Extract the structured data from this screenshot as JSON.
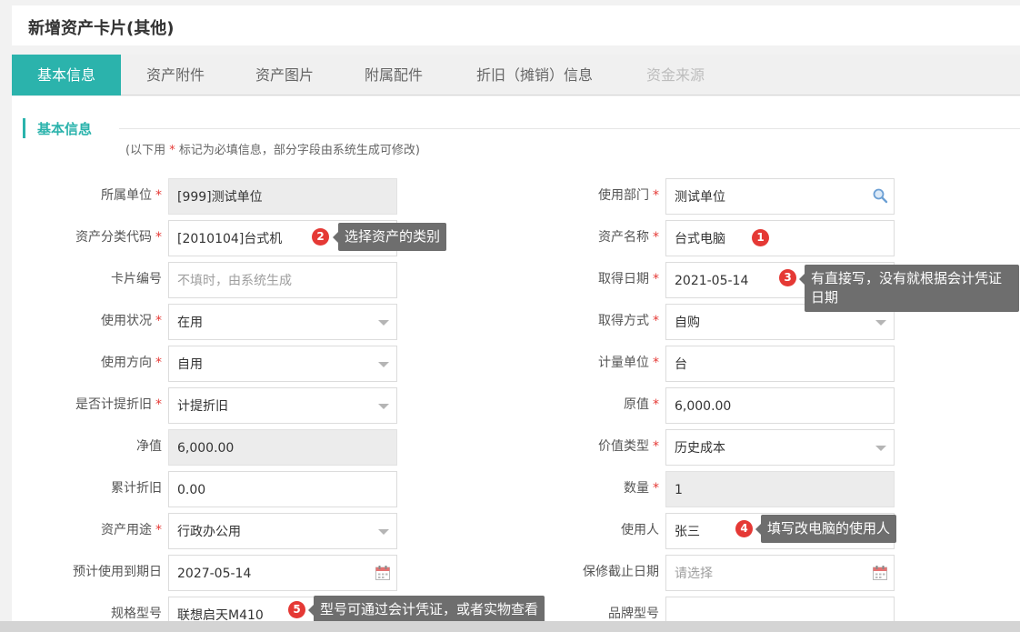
{
  "page": {
    "title": "新增资产卡片(其他)"
  },
  "tabs": [
    {
      "label": "基本信息",
      "active": true
    },
    {
      "label": "资产附件"
    },
    {
      "label": "资产图片"
    },
    {
      "label": "附属配件"
    },
    {
      "label": "折旧（摊销）信息"
    },
    {
      "label": "资金来源",
      "disabled": true
    }
  ],
  "section": {
    "title": "基本信息",
    "note_prefix": "(以下用",
    "note_star": "*",
    "note_suffix": " 标记为必填信息，部分字段由系统生成可修改)"
  },
  "form": {
    "left": [
      {
        "label": "所属单位",
        "required": true,
        "value": "[999]测试单位",
        "readonly": true
      },
      {
        "label": "资产分类代码",
        "required": true,
        "value": "[2010104]台式机"
      },
      {
        "label": "卡片编号",
        "required": false,
        "placeholder": "不填时，由系统生成"
      },
      {
        "label": "使用状况",
        "required": true,
        "value": "在用",
        "type": "select"
      },
      {
        "label": "使用方向",
        "required": true,
        "value": "自用",
        "type": "select"
      },
      {
        "label": "是否计提折旧",
        "required": true,
        "value": "计提折旧",
        "type": "select"
      },
      {
        "label": "净值",
        "required": false,
        "value": "6,000.00",
        "readonly": true
      },
      {
        "label": "累计折旧",
        "required": false,
        "value": "0.00"
      },
      {
        "label": "资产用途",
        "required": true,
        "value": "行政办公用",
        "type": "select"
      },
      {
        "label": "预计使用到期日",
        "required": false,
        "value": "2027-05-14",
        "type": "date"
      },
      {
        "label": "规格型号",
        "required": false,
        "value": "联想启天M410"
      }
    ],
    "right": [
      {
        "label": "使用部门",
        "required": true,
        "value": "测试单位",
        "type": "search"
      },
      {
        "label": "资产名称",
        "required": true,
        "value": "台式电脑"
      },
      {
        "label": "取得日期",
        "required": true,
        "value": "2021-05-14",
        "type": "date"
      },
      {
        "label": "取得方式",
        "required": true,
        "value": "自购",
        "type": "select"
      },
      {
        "label": "计量单位",
        "required": true,
        "value": "台"
      },
      {
        "label": "原值",
        "required": true,
        "value": "6,000.00"
      },
      {
        "label": "价值类型",
        "required": true,
        "value": "历史成本",
        "type": "select"
      },
      {
        "label": "数量",
        "required": true,
        "value": "1",
        "readonly": true
      },
      {
        "label": "使用人",
        "required": false,
        "value": "张三"
      },
      {
        "label": "保修截止日期",
        "required": false,
        "placeholder": "请选择",
        "type": "date"
      },
      {
        "label": "品牌型号",
        "required": false,
        "value": ""
      }
    ]
  },
  "annotations": [
    {
      "num": "1",
      "text": ""
    },
    {
      "num": "2",
      "text": "选择资产的类别"
    },
    {
      "num": "3",
      "text_line1": "有直接写，没有就根据会计凭证",
      "text_line2": "日期"
    },
    {
      "num": "4",
      "text": "填写改电脑的使用人"
    },
    {
      "num": "5",
      "text": "型号可通过会计凭证，或者实物查看"
    }
  ],
  "colors": {
    "accent": "#2bb3ac",
    "required": "#e53935",
    "badge": "#e53935",
    "tooltip": "#6e6e6e"
  }
}
